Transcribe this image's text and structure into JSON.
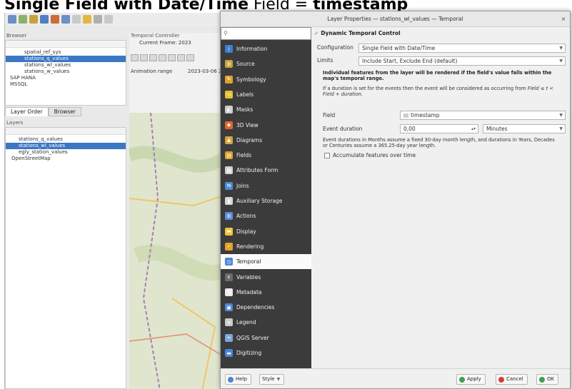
{
  "heading": {
    "bold_part": "Single Field with Date/Time",
    "thin_part": " Field = ",
    "field_name": "timestamp"
  },
  "qgis": {
    "browser_title": "Browser",
    "browser_items": [
      "spatial_ref_sys",
      "stations_q_values",
      "stations_wl_values",
      "stations_w_values",
      "SAP HANA",
      "MSSQL"
    ],
    "browser_selected": 1,
    "layer_tabs": [
      "Layer Order",
      "Browser"
    ],
    "layers_title": "Layers",
    "layer_items": [
      "stations_q_values",
      "stations_wl_values",
      "egly_station_values",
      "OpenStreetMap"
    ],
    "layer_selected": 1,
    "temporal_title": "Temporal Controller",
    "current_frame": "Current Frame: 2023",
    "animation_range_label": "Animation range",
    "animation_range_value": "2023-03-06 2"
  },
  "dialog": {
    "title": "Layer Properties — stations_wl_values — Temporal",
    "close_glyph": "×",
    "nav": [
      {
        "label": "Information",
        "icon": "information-icon",
        "color": "#3d7fd1",
        "glyph": "i"
      },
      {
        "label": "Source",
        "icon": "source-icon",
        "color": "#c9a33b",
        "glyph": "⚙"
      },
      {
        "label": "Symbology",
        "icon": "symbology-icon",
        "color": "#e0a22e",
        "glyph": "✎"
      },
      {
        "label": "Labels",
        "icon": "labels-icon",
        "color": "#e6c332",
        "glyph": "▭"
      },
      {
        "label": "Masks",
        "icon": "masks-icon",
        "color": "#cccccc",
        "glyph": "◐"
      },
      {
        "label": "3D View",
        "icon": "3d-view-icon",
        "color": "#e0662a",
        "glyph": "◆"
      },
      {
        "label": "Diagrams",
        "icon": "diagrams-icon",
        "color": "#d9a43a",
        "glyph": "▲"
      },
      {
        "label": "Fields",
        "icon": "fields-icon",
        "color": "#d9a22e",
        "glyph": "▤"
      },
      {
        "label": "Attributes Form",
        "icon": "attributes-form-icon",
        "color": "#d0d0d0",
        "glyph": "▦"
      },
      {
        "label": "Joins",
        "icon": "joins-icon",
        "color": "#4e8bd6",
        "glyph": "⇆"
      },
      {
        "label": "Auxiliary Storage",
        "icon": "auxiliary-storage-icon",
        "color": "#d8d8d8",
        "glyph": "▮"
      },
      {
        "label": "Actions",
        "icon": "actions-icon",
        "color": "#5b8ed8",
        "glyph": "⚙"
      },
      {
        "label": "Display",
        "icon": "display-icon",
        "color": "#f0c43a",
        "glyph": "▬"
      },
      {
        "label": "Rendering",
        "icon": "rendering-icon",
        "color": "#e5a02b",
        "glyph": "✓"
      },
      {
        "label": "Temporal",
        "icon": "temporal-icon",
        "color": "#4a86d4",
        "glyph": "◷"
      },
      {
        "label": "Variables",
        "icon": "variables-icon",
        "color": "#6b6b6b",
        "glyph": "ε"
      },
      {
        "label": "Metadata",
        "icon": "metadata-icon",
        "color": "#e9e9e9",
        "glyph": "▤"
      },
      {
        "label": "Dependencies",
        "icon": "dependencies-icon",
        "color": "#4a86d4",
        "glyph": "▣"
      },
      {
        "label": "Legend",
        "icon": "legend-icon",
        "color": "#c9c9c9",
        "glyph": "≡"
      },
      {
        "label": "QGIS Server",
        "icon": "qgis-server-icon",
        "color": "#7aa6dc",
        "glyph": "≈"
      },
      {
        "label": "Digitizing",
        "icon": "digitizing-icon",
        "color": "#4a86d4",
        "glyph": "▬"
      }
    ],
    "nav_selected": 14,
    "group_title": "Dynamic Temporal Control",
    "group_check": "✓",
    "configuration_label": "Configuration",
    "configuration_value": "Single Field with Date/Time",
    "limits_label": "Limits",
    "limits_value": "Include Start, Exclude End (default)",
    "info_bold": "Individual features from the layer will be rendered if the field's value falls within the map's temporal range.",
    "info_text_1": "If a duration is set for the events then the event will be considered as occurring from",
    "info_text_2": "Field ≤ t < Field + duration.",
    "field_label": "Field",
    "field_value": "timestamp",
    "event_duration_label": "Event duration",
    "event_duration_value": "0,00",
    "event_duration_unit": "Minutes",
    "duration_note": "Event durations in Months assume a fixed 30-day month length, and durations in Years, Decades or Centuries assume a 365.25-day year length.",
    "accumulate_label": "Accumulate features over time",
    "footer": {
      "help": "Help",
      "style": "Style",
      "apply": "Apply",
      "cancel": "Cancel",
      "ok": "OK"
    }
  }
}
